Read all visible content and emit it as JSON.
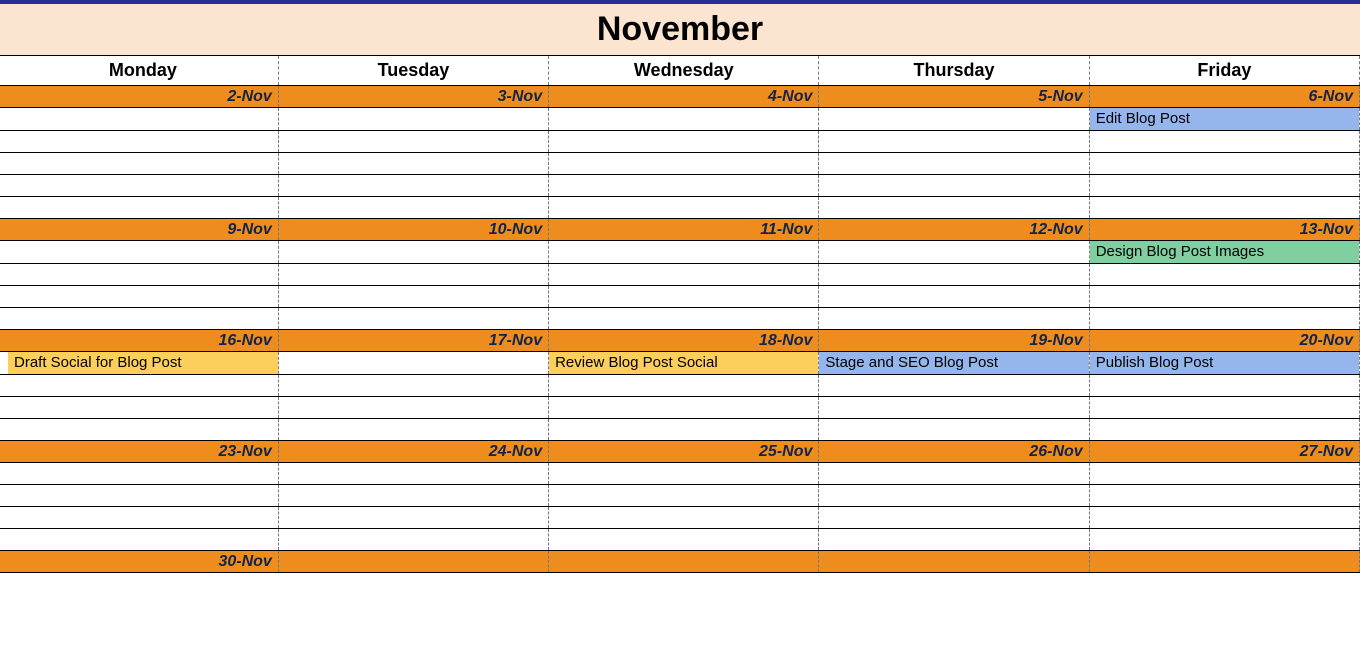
{
  "month_title": "November",
  "day_headers": [
    "Monday",
    "Tuesday",
    "Wednesday",
    "Thursday",
    "Friday"
  ],
  "weeks": [
    {
      "dates": [
        "2-Nov",
        "3-Nov",
        "4-Nov",
        "5-Nov",
        "6-Nov"
      ],
      "slots": [
        [
          {
            "text": "",
            "color": ""
          },
          {
            "text": "",
            "color": ""
          },
          {
            "text": "",
            "color": ""
          },
          {
            "text": "",
            "color": ""
          },
          {
            "text": "Edit Blog Post",
            "color": "blue"
          }
        ],
        [
          {
            "text": "",
            "color": ""
          },
          {
            "text": "",
            "color": ""
          },
          {
            "text": "",
            "color": ""
          },
          {
            "text": "",
            "color": ""
          },
          {
            "text": "",
            "color": ""
          }
        ],
        [
          {
            "text": "",
            "color": ""
          },
          {
            "text": "",
            "color": ""
          },
          {
            "text": "",
            "color": ""
          },
          {
            "text": "",
            "color": ""
          },
          {
            "text": "",
            "color": ""
          }
        ],
        [
          {
            "text": "",
            "color": ""
          },
          {
            "text": "",
            "color": ""
          },
          {
            "text": "",
            "color": ""
          },
          {
            "text": "",
            "color": ""
          },
          {
            "text": "",
            "color": ""
          }
        ],
        [
          {
            "text": "",
            "color": ""
          },
          {
            "text": "",
            "color": ""
          },
          {
            "text": "",
            "color": ""
          },
          {
            "text": "",
            "color": ""
          },
          {
            "text": "",
            "color": ""
          }
        ]
      ]
    },
    {
      "dates": [
        "9-Nov",
        "10-Nov",
        "11-Nov",
        "12-Nov",
        "13-Nov"
      ],
      "slots": [
        [
          {
            "text": "",
            "color": ""
          },
          {
            "text": "",
            "color": ""
          },
          {
            "text": "",
            "color": ""
          },
          {
            "text": "",
            "color": ""
          },
          {
            "text": "Design Blog Post Images",
            "color": "green"
          }
        ],
        [
          {
            "text": "",
            "color": ""
          },
          {
            "text": "",
            "color": ""
          },
          {
            "text": "",
            "color": ""
          },
          {
            "text": "",
            "color": ""
          },
          {
            "text": "",
            "color": ""
          }
        ],
        [
          {
            "text": "",
            "color": ""
          },
          {
            "text": "",
            "color": ""
          },
          {
            "text": "",
            "color": ""
          },
          {
            "text": "",
            "color": ""
          },
          {
            "text": "",
            "color": ""
          }
        ],
        [
          {
            "text": "",
            "color": ""
          },
          {
            "text": "",
            "color": ""
          },
          {
            "text": "",
            "color": ""
          },
          {
            "text": "",
            "color": ""
          },
          {
            "text": "",
            "color": ""
          }
        ]
      ]
    },
    {
      "dates": [
        "16-Nov",
        "17-Nov",
        "18-Nov",
        "19-Nov",
        "20-Nov"
      ],
      "slots": [
        [
          {
            "text": "Draft Social for Blog Post",
            "color": "yellow"
          },
          {
            "text": "",
            "color": ""
          },
          {
            "text": "Review Blog Post Social",
            "color": "yellow"
          },
          {
            "text": "Stage and SEO Blog Post",
            "color": "blue"
          },
          {
            "text": "Publish Blog Post",
            "color": "blue"
          }
        ],
        [
          {
            "text": "",
            "color": ""
          },
          {
            "text": "",
            "color": ""
          },
          {
            "text": "",
            "color": ""
          },
          {
            "text": "",
            "color": ""
          },
          {
            "text": "",
            "color": ""
          }
        ],
        [
          {
            "text": "",
            "color": ""
          },
          {
            "text": "",
            "color": ""
          },
          {
            "text": "",
            "color": ""
          },
          {
            "text": "",
            "color": ""
          },
          {
            "text": "",
            "color": ""
          }
        ],
        [
          {
            "text": "",
            "color": ""
          },
          {
            "text": "",
            "color": ""
          },
          {
            "text": "",
            "color": ""
          },
          {
            "text": "",
            "color": ""
          },
          {
            "text": "",
            "color": ""
          }
        ]
      ]
    },
    {
      "dates": [
        "23-Nov",
        "24-Nov",
        "25-Nov",
        "26-Nov",
        "27-Nov"
      ],
      "slots": [
        [
          {
            "text": "",
            "color": ""
          },
          {
            "text": "",
            "color": ""
          },
          {
            "text": "",
            "color": ""
          },
          {
            "text": "",
            "color": ""
          },
          {
            "text": "",
            "color": ""
          }
        ],
        [
          {
            "text": "",
            "color": ""
          },
          {
            "text": "",
            "color": ""
          },
          {
            "text": "",
            "color": ""
          },
          {
            "text": "",
            "color": ""
          },
          {
            "text": "",
            "color": ""
          }
        ],
        [
          {
            "text": "",
            "color": ""
          },
          {
            "text": "",
            "color": ""
          },
          {
            "text": "",
            "color": ""
          },
          {
            "text": "",
            "color": ""
          },
          {
            "text": "",
            "color": ""
          }
        ],
        [
          {
            "text": "",
            "color": ""
          },
          {
            "text": "",
            "color": ""
          },
          {
            "text": "",
            "color": ""
          },
          {
            "text": "",
            "color": ""
          },
          {
            "text": "",
            "color": ""
          }
        ]
      ]
    },
    {
      "dates": [
        "30-Nov",
        "",
        "",
        "",
        ""
      ],
      "slots": []
    }
  ]
}
